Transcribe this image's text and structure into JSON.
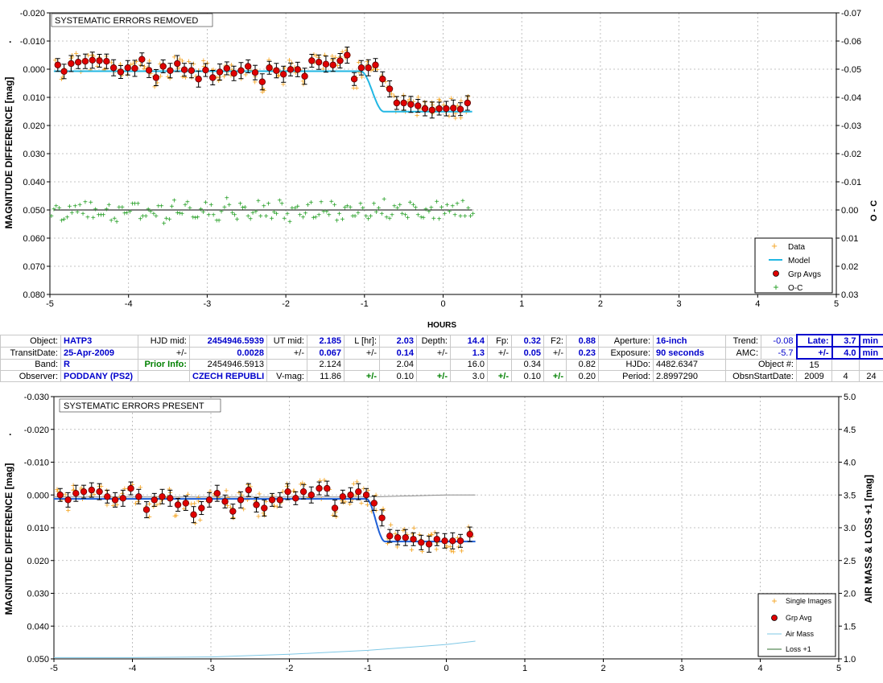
{
  "colors": {
    "data": "#f4a21c",
    "model": "#22b7e3",
    "grp": "#e00000",
    "oc": "#1a9a1a",
    "airmass": "#7fc8e6",
    "loss": "#2f6f2f",
    "model2": "#1f5fd6"
  },
  "top_chart": {
    "title_box": "SYSTEMATIC ERRORS REMOVED",
    "ylabel": "MAGNITUDE DIFFERENCE [mag]",
    "ylabel_dot": "·",
    "y2label": "O - C",
    "xlabel": "HOURS",
    "legend": [
      "Data",
      "Model",
      "Grp Avgs",
      "O-C"
    ]
  },
  "bottom_chart": {
    "title_box": "SYSTEMATIC ERRORS PRESENT",
    "ylabel": "MAGNITUDE DIFFERENCE [mag]",
    "ylabel_dot": "·",
    "y2label": "AIR MASS & LOSS +1 [mag]",
    "legend": [
      "Single Images",
      "Grp Avg",
      "Air Mass",
      "Loss +1"
    ]
  },
  "info": {
    "r1": [
      "Object:",
      "HATP3",
      "HJD mid:",
      "2454946.5939",
      "UT mid:",
      "2.185",
      "L [hr]:",
      "2.03",
      "Depth:",
      "14.4",
      "Fp:",
      "0.32",
      "F2:",
      "0.88",
      "Aperture:",
      "16-inch",
      "Trend:",
      "-0.08",
      "Late:",
      "3.7",
      "min"
    ],
    "r2": [
      "TransitDate:",
      "25-Apr-2009",
      "+/-",
      "0.0028",
      "+/-",
      "0.067",
      "+/-",
      "0.14",
      "+/-",
      "1.3",
      "+/-",
      "0.05",
      "+/-",
      "0.23",
      "Exposure:",
      "90 seconds",
      "AMC:",
      "-5.7",
      "+/-",
      "4.0",
      "min"
    ],
    "r3": [
      "Band:",
      "R",
      "Prior Info:",
      "2454946.5913",
      "2.124",
      "2.04",
      "16.0",
      "0.34",
      "0.82",
      "HJDo:",
      "4482.6347",
      "Object #:",
      "15"
    ],
    "r4": [
      "Observer:",
      "PODDANY (PS2)",
      "CZECH REPUBLI",
      "V-mag:",
      "11.86",
      "+/-",
      "0.10",
      "+/-",
      "3.0",
      "+/-",
      "0.10",
      "+/-",
      "0.20",
      "Period:",
      "2.8997290",
      "ObsnStartDate:",
      "2009",
      "4",
      "24"
    ]
  },
  "chart_data": [
    {
      "type": "scatter",
      "title": "SYSTEMATIC ERRORS REMOVED",
      "xlabel": "HOURS",
      "ylabel": "MAGNITUDE DIFFERENCE [mag]",
      "y2label": "O - C",
      "xlim": [
        -5,
        5
      ],
      "ylim": [
        -0.02,
        0.08
      ],
      "y_inverted": true,
      "y2lim": [
        -0.07,
        0.03
      ],
      "xticks": [
        "-5",
        "-4",
        "-3",
        "-2",
        "-1",
        "0",
        "1",
        "2",
        "3",
        "4",
        "5"
      ],
      "yticks": [
        "-0.020",
        "-0.010",
        "0.000",
        "0.010",
        "0.020",
        "0.030",
        "0.040",
        "0.050",
        "0.060",
        "0.070",
        "0.080"
      ],
      "y2ticks": [
        "-0.07",
        "-0.06",
        "-0.05",
        "-0.04",
        "-0.03",
        "-0.02",
        "-0.01",
        "0.00",
        "0.01",
        "0.02",
        "0.03"
      ],
      "legend_position": "bottom-right",
      "grid": true,
      "model": {
        "baseline": 0.0007,
        "depth": 0.0144,
        "ingress_start": -1.05,
        "ingress_end": -0.75,
        "x_start": -4.95,
        "x_end": 0.37
      },
      "series": [
        {
          "name": "Grp Avgs",
          "x": [
            -4.9,
            -4.82,
            -4.73,
            -4.64,
            -4.55,
            -4.46,
            -4.37,
            -4.28,
            -4.19,
            -4.1,
            -4.01,
            -3.92,
            -3.83,
            -3.74,
            -3.65,
            -3.56,
            -3.47,
            -3.38,
            -3.29,
            -3.2,
            -3.11,
            -3.02,
            -2.93,
            -2.84,
            -2.75,
            -2.66,
            -2.57,
            -2.48,
            -2.39,
            -2.3,
            -2.21,
            -2.12,
            -2.03,
            -1.94,
            -1.85,
            -1.76,
            -1.67,
            -1.58,
            -1.49,
            -1.4,
            -1.31,
            -1.22,
            -1.13,
            -1.04,
            -0.95,
            -0.86,
            -0.77,
            -0.68,
            -0.59,
            -0.5,
            -0.41,
            -0.32,
            -0.23,
            -0.14,
            -0.05,
            0.04,
            0.13,
            0.22,
            0.31
          ],
          "y": [
            -0.0015,
            0.0008,
            -0.002,
            -0.0025,
            -0.0028,
            -0.0032,
            -0.003,
            -0.0028,
            -0.0005,
            0.001,
            -0.0005,
            -0.0003,
            -0.0035,
            0.0004,
            0.003,
            -0.001,
            0.0005,
            -0.002,
            0.0002,
            0.0005,
            0.0035,
            0.0003,
            0.003,
            0.001,
            -0.0003,
            0.0015,
            0.0005,
            -0.001,
            0.0012,
            0.0045,
            -0.0005,
            0.0005,
            0.0018,
            0.0001,
            0.0001,
            0.0025,
            -0.003,
            -0.0025,
            -0.0018,
            -0.0015,
            -0.003,
            -0.005,
            0.0035,
            -0.0005,
            -0.0005,
            -0.0015,
            0.0035,
            0.007,
            0.012,
            0.012,
            0.0125,
            0.013,
            0.014,
            0.0145,
            0.014,
            0.014,
            0.0138,
            0.0142,
            0.012
          ]
        },
        {
          "name": "O-C",
          "x": [
            -4.95,
            -4.85,
            -4.75,
            -4.65,
            -4.55,
            -4.45,
            -4.35,
            -4.25,
            -4.15,
            -4.05,
            -3.95,
            -3.85,
            -3.75,
            -3.65,
            -3.55,
            -3.45,
            -3.35,
            -3.25,
            -3.15,
            -3.05,
            -2.95,
            -2.85,
            -2.75,
            -2.65,
            -2.55,
            -2.45,
            -2.35,
            -2.25,
            -2.15,
            -2.05,
            -1.95,
            -1.85,
            -1.75,
            -1.65,
            -1.55,
            -1.45,
            -1.35,
            -1.25,
            -1.15,
            -1.05,
            -0.95,
            -0.85,
            -0.75,
            -0.65,
            -0.55,
            -0.45,
            -0.35,
            -0.25,
            -0.15,
            -0.05,
            0.05,
            0.15,
            0.25,
            0.35
          ],
          "y": [
            0.0025,
            -0.001,
            0.003,
            -0.002,
            0.0015,
            -0.0035,
            0.002,
            -0.0005,
            0.0035,
            -0.0015,
            0.0005,
            -0.003,
            0.0025,
            0.0015,
            -0.002,
            0.004,
            0.001,
            -0.0025,
            0.003,
            -0.0005,
            0.002,
            0.0045,
            -0.0015,
            0.001,
            -0.003,
            0.0025,
            0.0005,
            -0.002,
            0.0035,
            -0.0045,
            0.0015,
            -0.001,
            0.003,
            -0.0035,
            0.002,
            0.0005,
            -0.0025,
            0.004,
            -0.0015,
            0.001,
            0.0025,
            -0.003,
            0.0015,
            0.0035,
            -0.001,
            0.002,
            -0.0025,
            0.003,
            0.0005,
            -0.004,
            0.0015,
            -0.002,
            0.0025,
            -0.001
          ]
        }
      ]
    },
    {
      "type": "scatter",
      "title": "SYSTEMATIC ERRORS PRESENT",
      "ylabel": "MAGNITUDE DIFFERENCE [mag]",
      "y2label": "AIR MASS & LOSS +1 [mag]",
      "xlim": [
        -5,
        5
      ],
      "ylim": [
        -0.03,
        0.05
      ],
      "y_inverted": true,
      "y2lim": [
        1.0,
        5.0
      ],
      "xticks": [
        "-5",
        "-4",
        "-3",
        "-2",
        "-1",
        "0",
        "1",
        "2",
        "3",
        "4",
        "5"
      ],
      "yticks": [
        "-0.030",
        "-0.020",
        "-0.010",
        "0.000",
        "0.010",
        "0.020",
        "0.030",
        "0.040",
        "0.050"
      ],
      "y2ticks": [
        "5.0",
        "4.5",
        "4.0",
        "3.5",
        "3.0",
        "2.5",
        "2.0",
        "1.5",
        "1.0"
      ],
      "legend_position": "bottom-right",
      "grid": true,
      "model": {
        "baseline": 0.0012,
        "depth": 0.013,
        "ingress_start": -1.02,
        "ingress_end": -0.78,
        "x_start": -5.0,
        "x_end": 0.37
      },
      "airmass": {
        "x": [
          -5.0,
          -4.0,
          -3.0,
          -2.0,
          -1.0,
          0.0,
          0.37
        ],
        "y": [
          1.02,
          1.02,
          1.03,
          1.07,
          1.13,
          1.22,
          1.27
        ]
      },
      "loss": {
        "x": [
          -5.0,
          -2.0,
          -1.0,
          0.0,
          0.37
        ],
        "y": [
          3.47,
          3.47,
          3.47,
          3.5,
          3.5
        ]
      },
      "series": [
        {
          "name": "Grp Avg",
          "x": [
            -4.92,
            -4.82,
            -4.72,
            -4.62,
            -4.52,
            -4.42,
            -4.32,
            -4.22,
            -4.12,
            -4.02,
            -3.92,
            -3.82,
            -3.72,
            -3.62,
            -3.52,
            -3.42,
            -3.32,
            -3.22,
            -3.12,
            -3.02,
            -2.92,
            -2.82,
            -2.72,
            -2.62,
            -2.52,
            -2.42,
            -2.32,
            -2.22,
            -2.12,
            -2.02,
            -1.92,
            -1.82,
            -1.72,
            -1.62,
            -1.52,
            -1.42,
            -1.32,
            -1.22,
            -1.12,
            -1.02,
            -0.92,
            -0.82,
            -0.72,
            -0.62,
            -0.52,
            -0.42,
            -0.32,
            -0.22,
            -0.12,
            -0.02,
            0.08,
            0.18,
            0.3
          ],
          "y": [
            0.0,
            0.0015,
            -0.0005,
            -0.001,
            -0.0015,
            -0.001,
            0.0005,
            0.0015,
            0.001,
            -0.002,
            0.0005,
            0.0045,
            0.0015,
            0.0005,
            0.001,
            0.003,
            0.0025,
            0.006,
            0.004,
            0.0015,
            -0.0005,
            0.002,
            0.005,
            0.0015,
            -0.0015,
            0.003,
            0.004,
            0.0015,
            0.0015,
            -0.001,
            0.001,
            -0.001,
            0.0,
            -0.002,
            -0.002,
            0.004,
            0.0005,
            0.0,
            -0.001,
            0.0,
            0.0025,
            0.007,
            0.0125,
            0.013,
            0.013,
            0.0135,
            0.0145,
            0.015,
            0.0135,
            0.014,
            0.014,
            0.014,
            0.012
          ]
        }
      ]
    }
  ]
}
